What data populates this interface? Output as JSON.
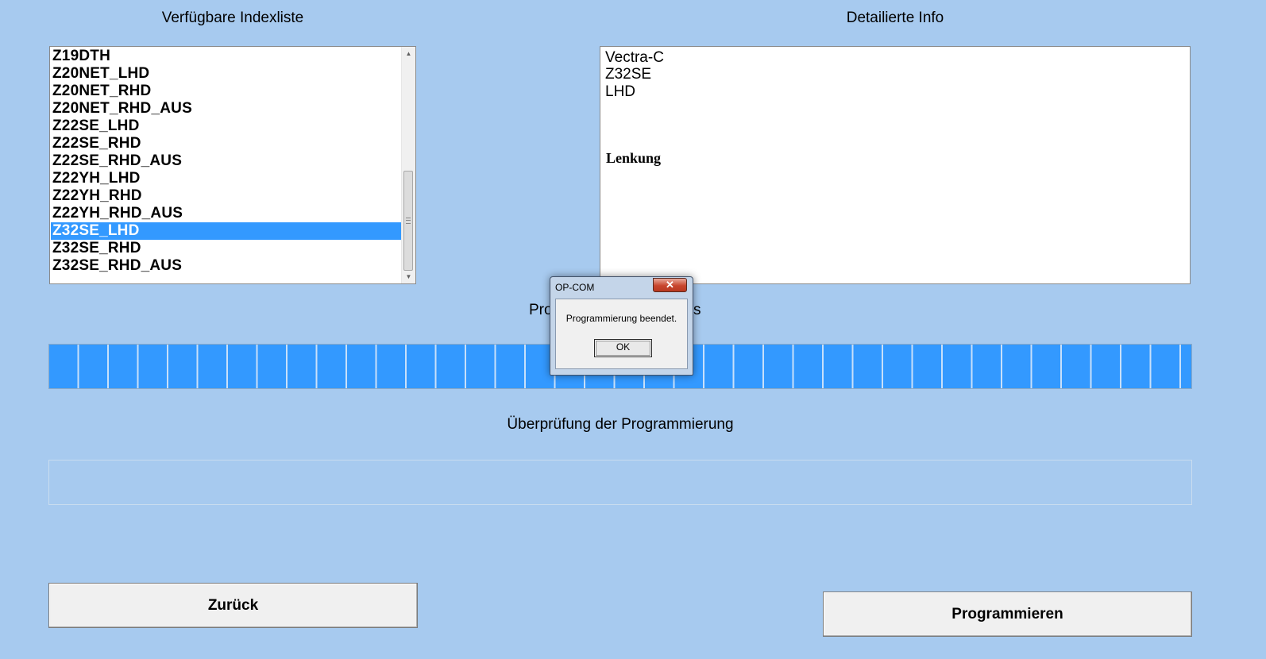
{
  "left_panel": {
    "title": "Verfügbare Indexliste",
    "items": [
      "Z19DTH",
      "Z20NET_LHD",
      "Z20NET_RHD",
      "Z20NET_RHD_AUS",
      "Z22SE_LHD",
      "Z22SE_RHD",
      "Z22SE_RHD_AUS",
      "Z22YH_LHD",
      "Z22YH_RHD",
      "Z22YH_RHD_AUS",
      "Z32SE_LHD",
      "Z32SE_RHD",
      "Z32SE_RHD_AUS"
    ],
    "selected_item": "Z32SE_LHD"
  },
  "right_panel": {
    "title": "Detailierte Info",
    "lines": [
      "Vectra-C",
      "Z32SE",
      "LHD"
    ],
    "heading": "Lenkung"
  },
  "progress_section": {
    "label_left": "Pro",
    "label_right": "s",
    "fill_fraction": 1.0,
    "fill_color": "#3399ff"
  },
  "verify_section": {
    "label": "Überprüfung der Programmierung",
    "fill_fraction": 0.0
  },
  "buttons": {
    "back_label": "Zurück",
    "program_label": "Programmieren"
  },
  "dialog": {
    "title": "OP-COM",
    "close_glyph": "✕",
    "message": "Programmierung beendet.",
    "ok_label": "OK"
  },
  "colors": {
    "background": "#a7caef",
    "selection": "#3399ff"
  }
}
